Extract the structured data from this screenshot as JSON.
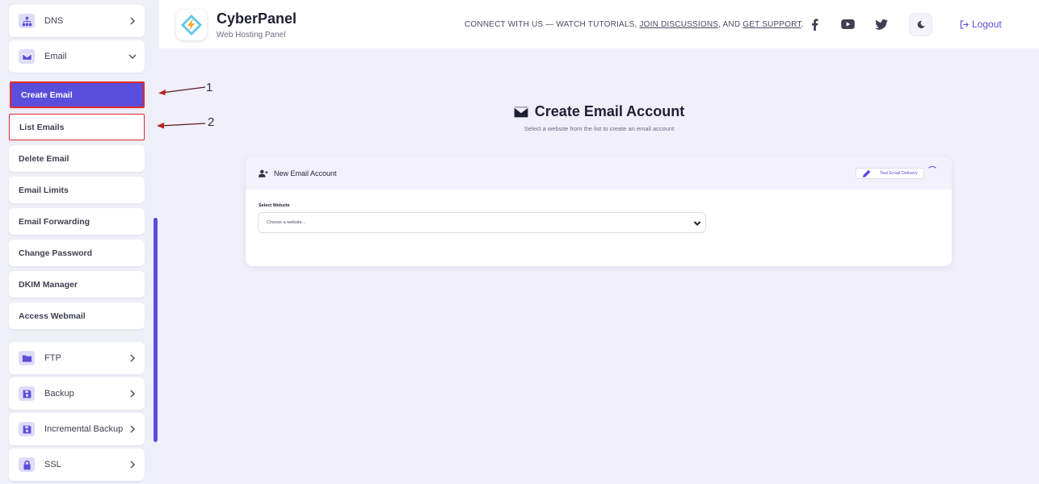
{
  "sidebar": {
    "dns_label": "DNS",
    "email_label": "Email",
    "email_items": [
      {
        "label": "Create Email"
      },
      {
        "label": "List Emails"
      },
      {
        "label": "Delete Email"
      },
      {
        "label": "Email Limits"
      },
      {
        "label": "Email Forwarding"
      },
      {
        "label": "Change Password"
      },
      {
        "label": "DKIM Manager"
      },
      {
        "label": "Access Webmail"
      }
    ],
    "ftp_label": "FTP",
    "backup_label": "Backup",
    "incremental_label": "Incremental Backup",
    "ssl_label": "SSL"
  },
  "annotations": {
    "first": "1",
    "second": "2"
  },
  "header": {
    "brand_title": "CyberPanel",
    "brand_subtitle": "Web Hosting Panel",
    "connect_prefix": "CONNECT WITH US — WATCH TUTORIALS, ",
    "connect_link1": "JOIN DISCUSSIONS",
    "connect_mid": ", AND ",
    "connect_link2": "GET SUPPORT",
    "connect_suffix": ".",
    "logout_label": "Logout",
    "accent": "#5a4fdc"
  },
  "main": {
    "title": "Create Email Account",
    "subtitle": "Select a website from the list to create an email account",
    "card_title": "New Email Account",
    "test_button": "Test Email Delivery",
    "field_label": "Select Website",
    "select_value": "Choose a website..."
  }
}
